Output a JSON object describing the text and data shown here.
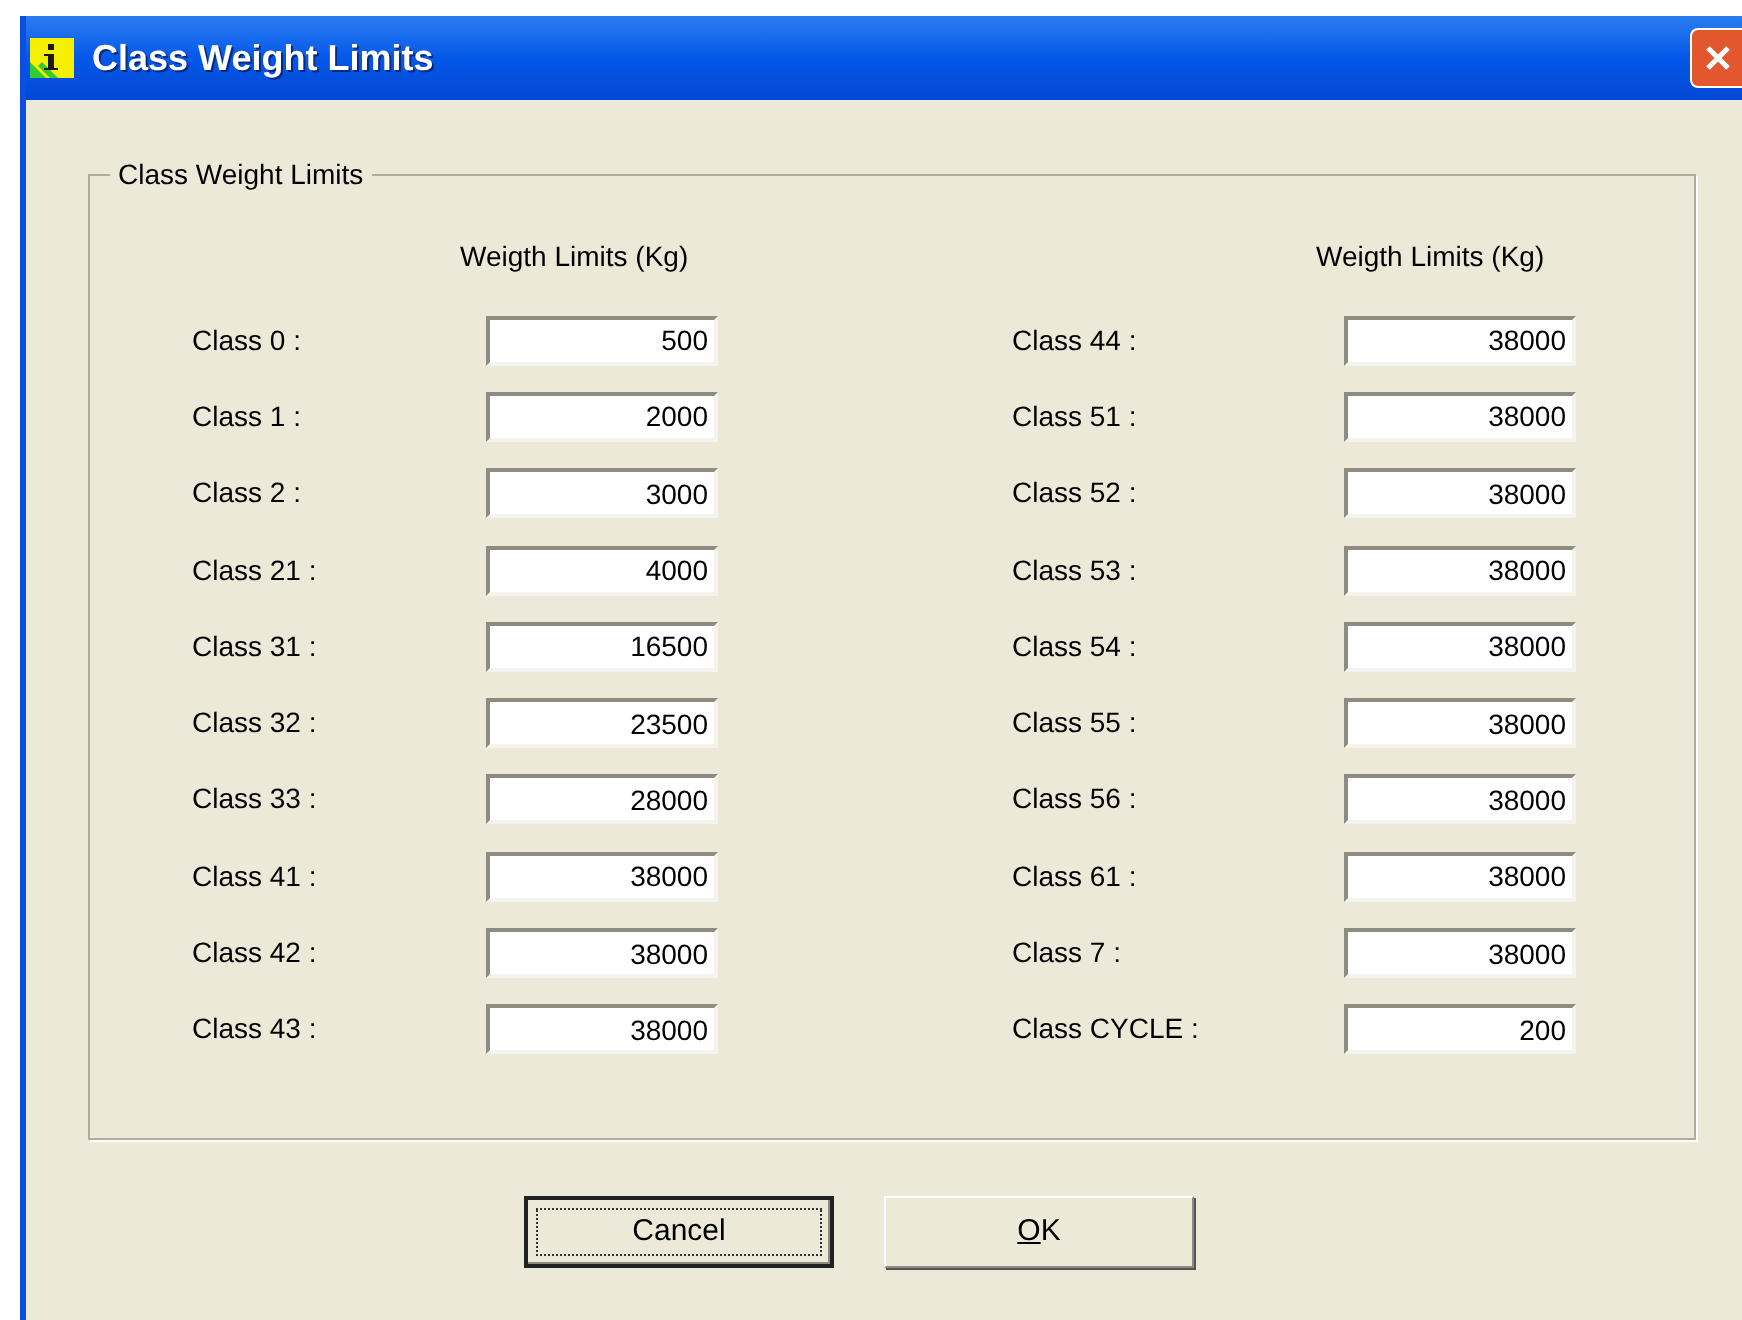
{
  "window": {
    "title": "Class Weight Limits"
  },
  "group": {
    "title": "Class Weight Limits",
    "columns": [
      {
        "header": "Weigth Limits (Kg)",
        "rows": [
          {
            "label": "Class 0 :",
            "value": "500"
          },
          {
            "label": "Class 1 :",
            "value": "2000"
          },
          {
            "label": "Class 2 :",
            "value": "3000"
          },
          {
            "label": "Class 21 :",
            "value": "4000"
          },
          {
            "label": "Class 31 :",
            "value": "16500"
          },
          {
            "label": "Class 32 :",
            "value": "23500"
          },
          {
            "label": "Class 33 :",
            "value": "28000"
          },
          {
            "label": "Class 41 :",
            "value": "38000"
          },
          {
            "label": "Class 42 :",
            "value": "38000"
          },
          {
            "label": "Class 43 :",
            "value": "38000"
          }
        ]
      },
      {
        "header": "Weigth Limits (Kg)",
        "rows": [
          {
            "label": "Class 44 :",
            "value": "38000"
          },
          {
            "label": "Class 51 :",
            "value": "38000"
          },
          {
            "label": "Class 52 :",
            "value": "38000"
          },
          {
            "label": "Class 53 :",
            "value": "38000"
          },
          {
            "label": "Class 54 :",
            "value": "38000"
          },
          {
            "label": "Class 55 :",
            "value": "38000"
          },
          {
            "label": "Class 56 :",
            "value": "38000"
          },
          {
            "label": "Class 61 :",
            "value": "38000"
          },
          {
            "label": "Class 7 :",
            "value": "38000"
          },
          {
            "label": "Class CYCLE :",
            "value": "200"
          }
        ]
      }
    ]
  },
  "buttons": [
    {
      "label": "Cancel",
      "focused": true
    },
    {
      "label": "OK",
      "focused": false
    }
  ]
}
